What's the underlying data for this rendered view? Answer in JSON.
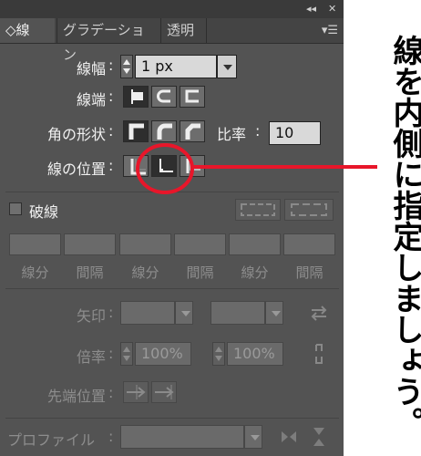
{
  "topbar": {
    "collapse": "◂◂",
    "close": "✕"
  },
  "tabs": [
    {
      "label": "◇線"
    },
    {
      "label": "グラデーション"
    },
    {
      "label": "透明"
    }
  ],
  "panel_menu": "▾☰",
  "stroke": {
    "weight_label": "線幅",
    "weight_value": "1 px",
    "cap_label": "線端",
    "corner_label": "角の形状",
    "ratio_label": "比率",
    "ratio_value": "10",
    "align_label": "線の位置"
  },
  "dashed": {
    "label": "破線",
    "checked": false,
    "columns": [
      "線分",
      "間隔",
      "線分",
      "間隔",
      "線分",
      "間隔"
    ]
  },
  "arrowheads": {
    "label": "矢印",
    "scale_label": "倍率",
    "scale_start": "100%",
    "scale_end": "100%",
    "align_label": "先端位置"
  },
  "profile": {
    "label": "プロファイル"
  },
  "colon": ":",
  "annotation": {
    "text": "線を内側に指定しましょう。",
    "highlight_color": "#e8162a"
  }
}
